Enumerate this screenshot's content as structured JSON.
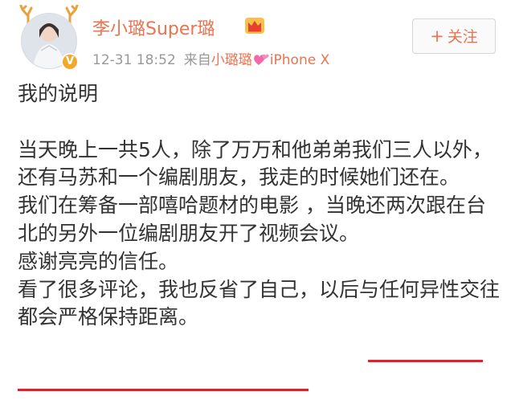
{
  "user": {
    "name": "李小璐Super璐",
    "verified_mark": "V"
  },
  "meta": {
    "timestamp": "12-31 18:52",
    "source_prefix": "来自",
    "source_name": "小璐璐",
    "source_device": "iPhone X"
  },
  "follow_button": {
    "plus": "+",
    "label": "关注"
  },
  "post": {
    "title": "我的说明",
    "paragraph_1": "当天晚上一共5人，除了万万和他弟弟我们三人以外，还有马苏和一个编剧朋友，我走的时候她们还在。",
    "paragraph_2": "我们在筹备一部嘻哈题材的电影 ，当晚还两次跟在台北的另外一位编剧朋友开了视频会议。",
    "paragraph_3": "感谢亮亮的信任。",
    "paragraph_4": "看了很多评论，我也反省了自己，以后与任何异性交往都会严格保持距离。"
  },
  "icons": {
    "avatar": "avatar-image",
    "verified": "verified-badge-icon",
    "crown": "vip-crown-icon",
    "antlers": "antler-frame-icon",
    "heart": "pink-hearts-icon"
  },
  "colors": {
    "username": "#eb7350",
    "meta_text": "#999999",
    "source_link": "#eb7350",
    "body_text": "#333333",
    "highlight_underline": "#e0202a",
    "verified_badge": "#f2a92a",
    "follow_text": "#eb7350"
  }
}
